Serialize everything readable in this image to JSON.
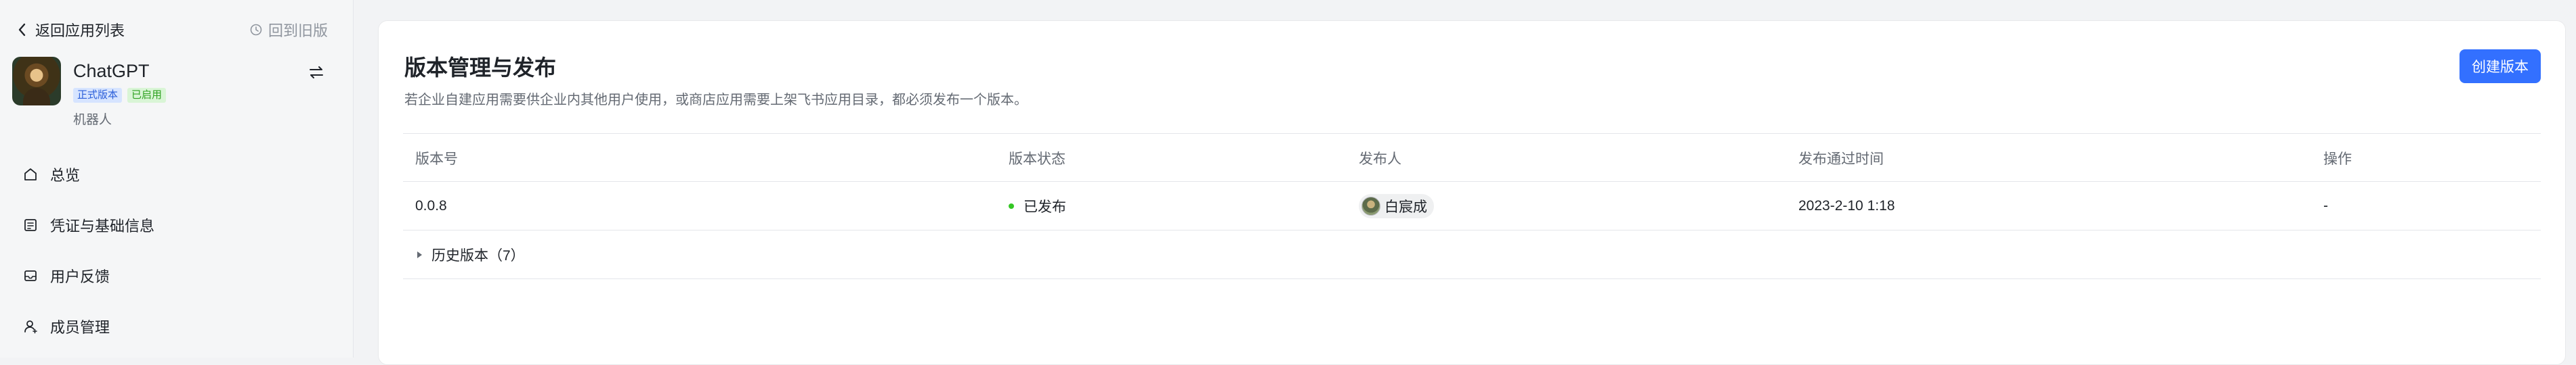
{
  "sidebar": {
    "back_label": "返回应用列表",
    "old_version_label": "回到旧版",
    "app": {
      "name": "ChatGPT",
      "badge_release": "正式版本",
      "badge_enabled": "已启用",
      "type": "机器人"
    },
    "nav": [
      {
        "label": "总览",
        "icon": "home-icon"
      },
      {
        "label": "凭证与基础信息",
        "icon": "credential-icon"
      },
      {
        "label": "用户反馈",
        "icon": "inbox-icon"
      },
      {
        "label": "成员管理",
        "icon": "member-icon"
      }
    ]
  },
  "main": {
    "title": "版本管理与发布",
    "description": "若企业自建应用需要供企业内其他用户使用，或商店应用需要上架飞书应用目录，都必须发布一个版本。",
    "create_button": "创建版本",
    "columns": [
      "版本号",
      "版本状态",
      "发布人",
      "发布通过时间",
      "操作"
    ],
    "rows": [
      {
        "version": "0.0.8",
        "status": "已发布",
        "publisher": "白宸成",
        "time": "2023-2-10 1:18",
        "action": "-"
      }
    ],
    "history_label": "历史版本（7）"
  },
  "colors": {
    "accent": "#3370ff",
    "status_published": "#34c724",
    "badge_release_bg": "#d6e4ff",
    "badge_enabled_bg": "#d9f5d6"
  }
}
